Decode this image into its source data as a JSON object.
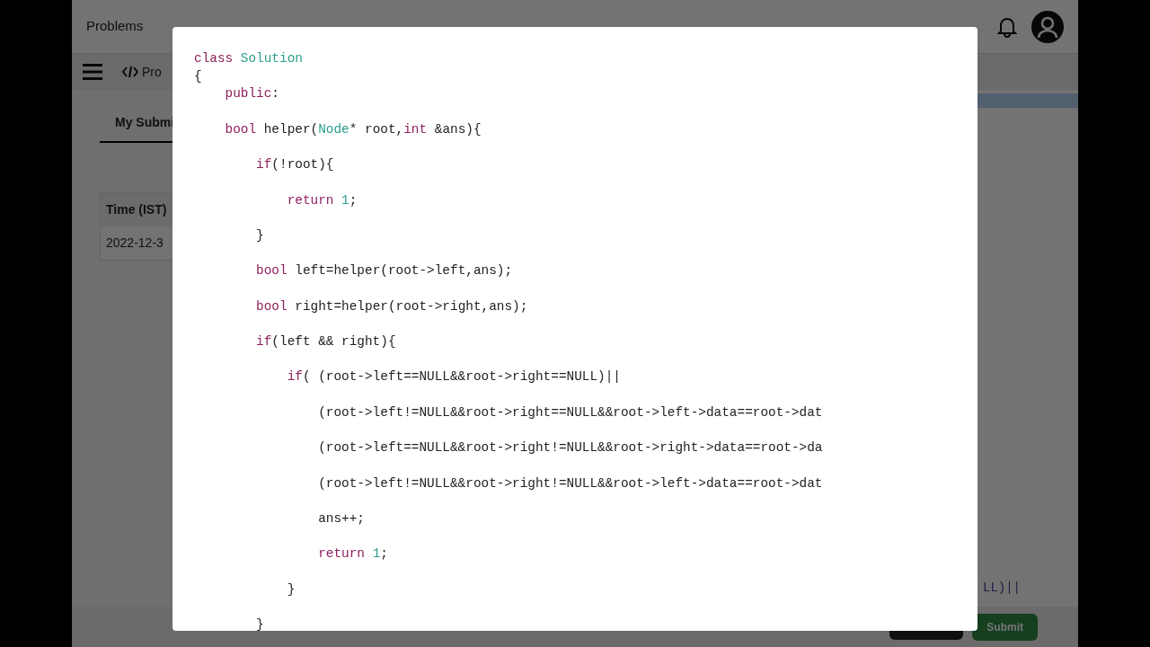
{
  "top_nav": {
    "links": [
      "Problems"
    ]
  },
  "toolbar": {
    "tab": "Pro"
  },
  "submissions": {
    "tab": {
      "label": "My Submi",
      "selected": true
    },
    "columns": [
      "Time (IST)"
    ],
    "rows": [
      [
        "2022-12-3"
      ]
    ]
  },
  "editor_peek": {
    "text": "LL)||"
  },
  "actions": {
    "submit": "Submit"
  },
  "modal": {
    "lines": [
      {
        "tokens": [
          {
            "kind": "keyword",
            "text": "class"
          },
          {
            "kind": "type",
            "text": " Solution"
          }
        ]
      },
      {
        "tokens": [
          {
            "kind": "plain",
            "text": "{"
          }
        ]
      },
      {
        "tokens": [
          {
            "kind": "keyword",
            "text": "    public"
          },
          {
            "kind": "plain",
            "text": ":"
          }
        ]
      },
      {
        "tokens": [
          {
            "kind": "keyword",
            "text": "    bool"
          },
          {
            "kind": "plain",
            "text": " helper("
          },
          {
            "kind": "type",
            "text": "Node"
          },
          {
            "kind": "plain",
            "text": "* root,"
          },
          {
            "kind": "keyword",
            "text": "int"
          },
          {
            "kind": "plain",
            "text": " &ans){"
          }
        ]
      },
      {
        "tokens": [
          {
            "kind": "keyword",
            "text": "        if"
          },
          {
            "kind": "plain",
            "text": "(!root){"
          }
        ]
      },
      {
        "tokens": [
          {
            "kind": "keyword",
            "text": "            return"
          },
          {
            "kind": "number",
            "text": " 1"
          },
          {
            "kind": "plain",
            "text": ";"
          }
        ]
      },
      {
        "tokens": [
          {
            "kind": "plain",
            "text": "        }"
          }
        ]
      },
      {
        "tokens": [
          {
            "kind": "keyword",
            "text": "        bool"
          },
          {
            "kind": "plain",
            "text": " left=helper(root->left,ans);"
          }
        ]
      },
      {
        "tokens": [
          {
            "kind": "keyword",
            "text": "        bool"
          },
          {
            "kind": "plain",
            "text": " right=helper(root->right,ans);"
          }
        ]
      },
      {
        "tokens": [
          {
            "kind": "keyword",
            "text": "        if"
          },
          {
            "kind": "plain",
            "text": "(left && right){"
          }
        ]
      },
      {
        "tokens": [
          {
            "kind": "keyword",
            "text": "            if"
          },
          {
            "kind": "plain",
            "text": "( (root->left==NULL&&root->right==NULL)||"
          }
        ]
      },
      {
        "tokens": [
          {
            "kind": "plain",
            "text": "                (root->left!=NULL&&root->right==NULL&&root->left->data==root->dat"
          }
        ]
      },
      {
        "tokens": [
          {
            "kind": "plain",
            "text": "                (root->left==NULL&&root->right!=NULL&&root->right->data==root->da"
          }
        ]
      },
      {
        "tokens": [
          {
            "kind": "plain",
            "text": "                (root->left!=NULL&&root->right!=NULL&&root->left->data==root->dat"
          }
        ]
      },
      {
        "tokens": [
          {
            "kind": "plain",
            "text": "                ans++;"
          }
        ]
      },
      {
        "tokens": [
          {
            "kind": "keyword",
            "text": "                return"
          },
          {
            "kind": "number",
            "text": " 1"
          },
          {
            "kind": "plain",
            "text": ";"
          }
        ]
      },
      {
        "tokens": [
          {
            "kind": "plain",
            "text": "            }"
          }
        ]
      },
      {
        "tokens": [
          {
            "kind": "plain",
            "text": "        }"
          }
        ]
      }
    ]
  }
}
